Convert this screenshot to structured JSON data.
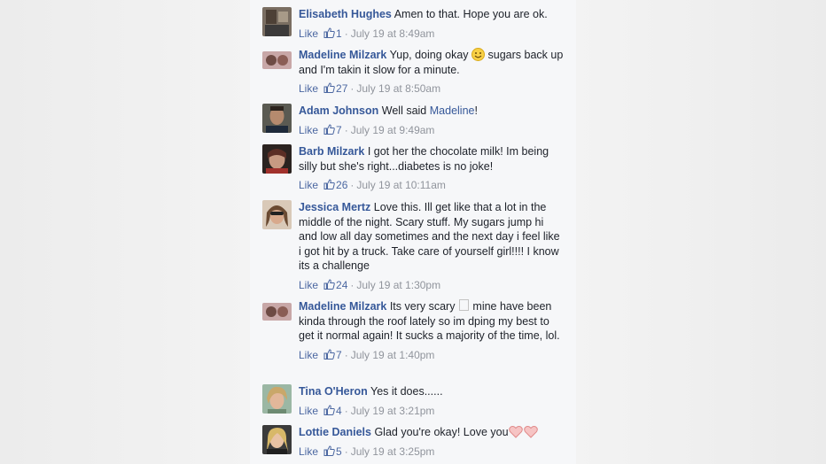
{
  "comments": [
    {
      "name": "Elisabeth Hughes",
      "text_before": "Amen to that. Hope you are ok.",
      "mention": "",
      "text_after": "",
      "like": "Like",
      "count": "1",
      "sep": "·",
      "time": "July 19 at 8:49am"
    },
    {
      "name": "Madeline Milzark",
      "text_before": "Yup, doing okay",
      "mention": "",
      "text_after": " sugars back up and I'm takin it slow for a minute.",
      "like": "Like",
      "count": "27",
      "sep": "·",
      "time": "July 19 at 8:50am"
    },
    {
      "name": "Adam Johnson",
      "text_before": "Well said ",
      "mention": "Madeline",
      "text_after": "!",
      "like": "Like",
      "count": "7",
      "sep": "·",
      "time": "July 19 at 9:49am"
    },
    {
      "name": "Barb Milzark",
      "text_before": "I got her the chocolate milk! Im being silly but she's right...diabetes is no joke!",
      "mention": "",
      "text_after": "",
      "like": "Like",
      "count": "26",
      "sep": "·",
      "time": "July 19 at 10:11am"
    },
    {
      "name": "Jessica Mertz",
      "text_before": "Love this. Ill get like that a lot in the middle of the night. Scary stuff. My sugars jump hi and low all day sometimes and the next day i feel like i got hit by a truck. Take care of yourself girl!!!! I know its a challenge",
      "mention": "",
      "text_after": "",
      "like": "Like",
      "count": "24",
      "sep": "·",
      "time": "July 19 at 1:30pm"
    },
    {
      "name": "Madeline Milzark",
      "text_before": "Its very scary",
      "mention": "",
      "text_after": " mine have been kinda through the roof lately so im dping my best to get it normal again! It sucks a majority of the time, lol.",
      "like": "Like",
      "count": "7",
      "sep": "·",
      "time": "July 19 at 1:40pm"
    },
    {
      "name": "Tina O'Heron",
      "text_before": "Yes it does......",
      "mention": "",
      "text_after": "",
      "like": "Like",
      "count": "4",
      "sep": "·",
      "time": "July 19 at 3:21pm"
    },
    {
      "name": "Lottie Daniels",
      "text_before": "Glad you're okay! Love you",
      "mention": "",
      "text_after": "",
      "like": "Like",
      "count": "5",
      "sep": "·",
      "time": "July 19 at 3:25pm"
    }
  ],
  "colors": {
    "name": "#365899",
    "meta": "#90949c",
    "panel": "#f6f7f9"
  }
}
